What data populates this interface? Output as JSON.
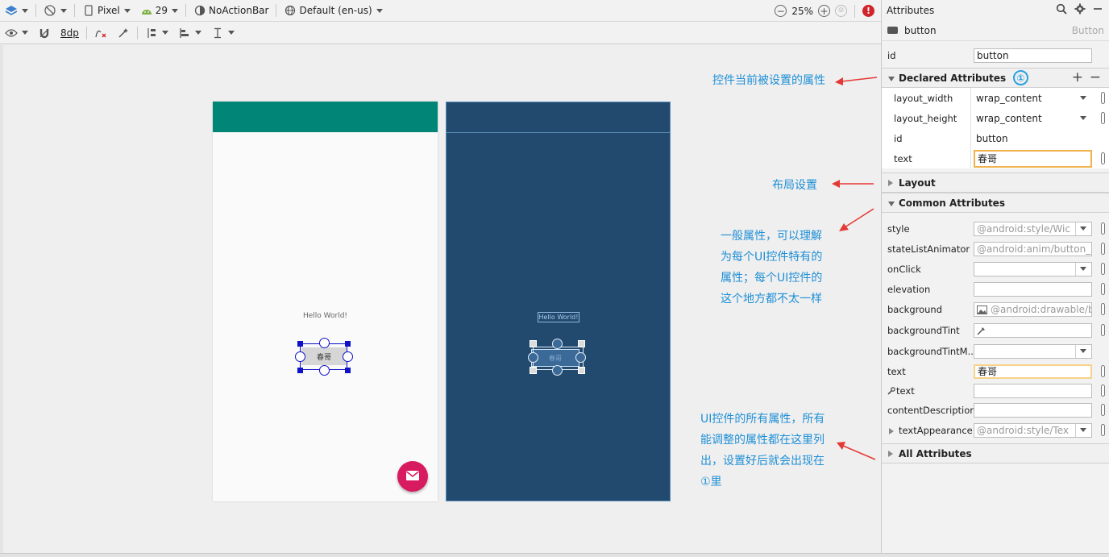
{
  "toolbar1": {
    "device": "Pixel",
    "api": "29",
    "theme": "NoActionBar",
    "locale": "Default (en-us)",
    "zoom": "25%"
  },
  "toolbar2": {
    "margin": "8dp"
  },
  "canvas": {
    "hello_text": "Hello World!",
    "button_text": "春哥",
    "blueprint_hello": "Hello World!",
    "blueprint_button": "春哥"
  },
  "annotations": {
    "declared": "控件当前被设置的属性",
    "layout": "布局设置",
    "common_lines": [
      "一般属性，可以理解",
      "为每个UI控件特有的",
      "属性；每个UI控件的",
      "这个地方都不太一样"
    ],
    "all_lines": [
      "UI控件的所有属性，所有",
      "能调整的属性都在这里列",
      "出，设置好后就会出现在",
      "①里"
    ]
  },
  "panel": {
    "title": "Attributes",
    "component_name": "button",
    "component_type": "Button",
    "id_label": "id",
    "id_value": "button",
    "declared_title": "Declared Attributes",
    "declared_badge": "①",
    "declared": [
      {
        "label": "layout_width",
        "value": "wrap_content"
      },
      {
        "label": "layout_height",
        "value": "wrap_content"
      },
      {
        "label": "id",
        "value": "button"
      },
      {
        "label": "text",
        "value": "春哥"
      }
    ],
    "layout_title": "Layout",
    "common_title": "Common Attributes",
    "common": [
      {
        "label": "style",
        "value": "@android:style/Wic"
      },
      {
        "label": "stateListAnimator",
        "value": "@android:anim/button_s"
      },
      {
        "label": "onClick",
        "value": ""
      },
      {
        "label": "elevation",
        "value": ""
      },
      {
        "label": "background",
        "value": "@android:drawable/b"
      },
      {
        "label": "backgroundTint",
        "value": ""
      },
      {
        "label": "backgroundTintM...",
        "value": ""
      },
      {
        "label": "text",
        "value": "春哥"
      },
      {
        "label": "text",
        "value": ""
      },
      {
        "label": "contentDescription",
        "value": ""
      },
      {
        "label": "textAppearance",
        "value": "@android:style/Tex"
      }
    ],
    "all_title": "All Attributes"
  },
  "colors": {
    "appbar": "#008577",
    "blueprint": "#214a6e",
    "fab": "#d81b60",
    "annotation": "#1e8fd6",
    "arrow": "#e53935"
  }
}
